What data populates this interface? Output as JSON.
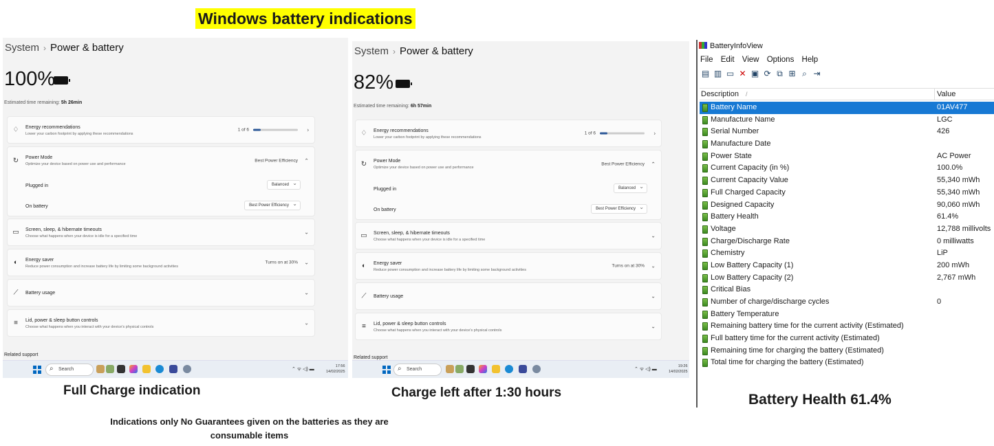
{
  "title": "Windows battery indications",
  "left_panel": {
    "breadcrumb": {
      "parent": "System",
      "current": "Power & battery"
    },
    "percent": "100%",
    "estimate_label": "Estimated time remaining:",
    "estimate_value": "5h 26min",
    "energy": {
      "title": "Energy recommendations",
      "desc": "Lower your carbon footprint by applying these recommendations",
      "count": "1 of 6",
      "progress": 0.17
    },
    "power_mode": {
      "title": "Power Mode",
      "desc": "Optimize your device based on power use and performance",
      "value": "Best Power Efficiency"
    },
    "plugged_in": {
      "label": "Plugged in",
      "value": "Balanced"
    },
    "on_battery": {
      "label": "On battery",
      "value": "Best Power Efficiency"
    },
    "screen_sleep": {
      "title": "Screen, sleep, & hibernate timeouts",
      "desc": "Choose what happens when your device is idle for a specified time"
    },
    "energy_saver": {
      "title": "Energy saver",
      "desc": "Reduce power consumption and increase battery life by limiting some background activities",
      "value": "Turns on at 30%"
    },
    "battery_usage": {
      "title": "Battery usage"
    },
    "lid": {
      "title": "Lid, power & sleep button controls",
      "desc": "Choose what happens when you interact with your device's physical controls"
    },
    "related": "Related support",
    "search": "Search",
    "time": "17:56",
    "date": "14/02/2025"
  },
  "right_panel": {
    "breadcrumb": {
      "parent": "System",
      "current": "Power & battery"
    },
    "percent": "82%",
    "estimate_label": "Estimated time remaining:",
    "estimate_value": "6h 57min",
    "energy": {
      "title": "Energy recommendations",
      "desc": "Lower your carbon footprint by applying these recommendations",
      "count": "1 of 6",
      "progress": 0.17
    },
    "power_mode": {
      "title": "Power Mode",
      "desc": "Optimize your device based on power use and performance",
      "value": "Best Power Efficiency"
    },
    "plugged_in": {
      "label": "Plugged in",
      "value": "Balanced"
    },
    "on_battery": {
      "label": "On battery",
      "value": "Best Power Efficiency"
    },
    "screen_sleep": {
      "title": "Screen, sleep, & hibernate timeouts",
      "desc": "Choose what happens when your device is idle for a specified time"
    },
    "energy_saver": {
      "title": "Energy saver",
      "desc": "Reduce power consumption and increase battery life by limiting some background activities",
      "value": "Turns on at 30%"
    },
    "battery_usage": {
      "title": "Battery usage"
    },
    "lid": {
      "title": "Lid, power & sleep button controls",
      "desc": "Choose what happens when you interact with your device's physical controls"
    },
    "related": "Related support",
    "search": "Search",
    "time": "19:26",
    "date": "14/02/2025"
  },
  "captions": {
    "left": "Full Charge indication",
    "middle": "Charge left after 1:30 hours",
    "right": "Battery Health 61.4%"
  },
  "note": "Indications only No Guarantees given on the batteries as they are consumable items",
  "battery_info_view": {
    "window_title": "BatteryInfoView",
    "menu": [
      "File",
      "Edit",
      "View",
      "Options",
      "Help"
    ],
    "columns": {
      "description": "Description",
      "value": "Value",
      "sort_marker": "/"
    },
    "rows": [
      {
        "d": "Battery Name",
        "v": "01AV477"
      },
      {
        "d": "Manufacture Name",
        "v": "LGC"
      },
      {
        "d": "Serial Number",
        "v": "426"
      },
      {
        "d": "Manufacture Date",
        "v": ""
      },
      {
        "d": "Power State",
        "v": "AC Power"
      },
      {
        "d": "Current Capacity (in %)",
        "v": "100.0%"
      },
      {
        "d": "Current Capacity Value",
        "v": "55,340 mWh"
      },
      {
        "d": "Full Charged Capacity",
        "v": "55,340 mWh"
      },
      {
        "d": "Designed Capacity",
        "v": "90,060 mWh"
      },
      {
        "d": "Battery Health",
        "v": "61.4%"
      },
      {
        "d": "Voltage",
        "v": "12,788 millivolts"
      },
      {
        "d": "Charge/Discharge Rate",
        "v": "0 milliwatts"
      },
      {
        "d": "Chemistry",
        "v": "LiP"
      },
      {
        "d": "Low Battery Capacity (1)",
        "v": "200 mWh"
      },
      {
        "d": "Low Battery Capacity (2)",
        "v": "2,767 mWh"
      },
      {
        "d": "Critical Bias",
        "v": ""
      },
      {
        "d": "Number of charge/discharge cycles",
        "v": "0"
      },
      {
        "d": "Battery Temperature",
        "v": ""
      },
      {
        "d": "Remaining battery time for the current activity (Estimated)",
        "v": ""
      },
      {
        "d": "Full battery time for the current activity (Estimated)",
        "v": ""
      },
      {
        "d": "Remaining time for charging the battery (Estimated)",
        "v": ""
      },
      {
        "d": "Total  time for charging the battery (Estimated)",
        "v": ""
      }
    ]
  }
}
